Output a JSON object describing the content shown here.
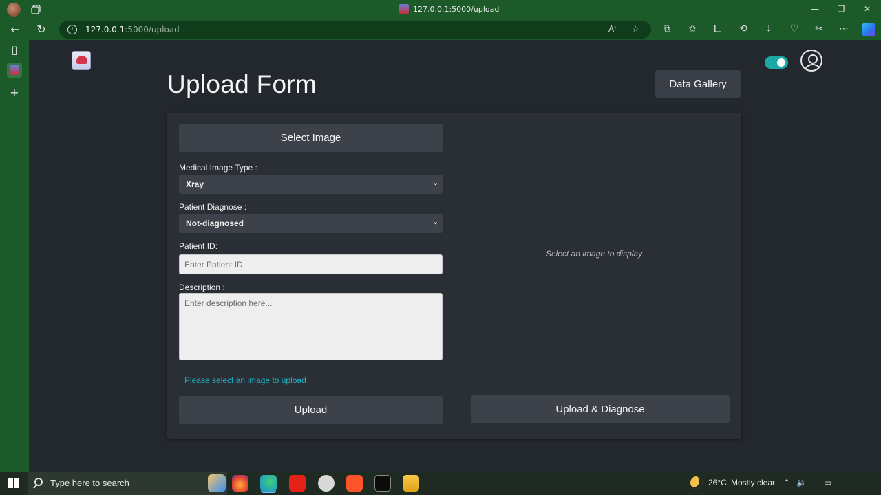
{
  "browser": {
    "tab_title": "127.0.0.1:5000/upload",
    "url_host": "127.0.0.1",
    "url_path": ":5000/upload"
  },
  "header": {
    "title": "Upload Form",
    "gallery_button": "Data Gallery",
    "theme_toggle_on": true
  },
  "form": {
    "select_image_button": "Select Image",
    "image_type_label": "Medical Image Type :",
    "image_type_value": "Xray",
    "diagnose_label": "Patient Diagnose :",
    "diagnose_value": "Not-diagnosed",
    "patient_id_label": "Patient ID:",
    "patient_id_placeholder": "Enter Patient ID",
    "description_label": "Description :",
    "description_placeholder": "Enter description here...",
    "status_message": "Please select an image to upload",
    "upload_button": "Upload",
    "upload_diagnose_button": "Upload & Diagnose"
  },
  "preview": {
    "placeholder": "Select an image to display"
  },
  "taskbar": {
    "search_placeholder": "Type here to search",
    "temperature": "26°C",
    "weather": "Mostly clear"
  },
  "colors": {
    "accent": "#1fb0c2",
    "toggle": "#1aa9a6",
    "page_bg": "#23272e",
    "card_bg": "#2a2e35",
    "button_bg": "#3d4149",
    "browser_frame": "#1c5a2a"
  }
}
